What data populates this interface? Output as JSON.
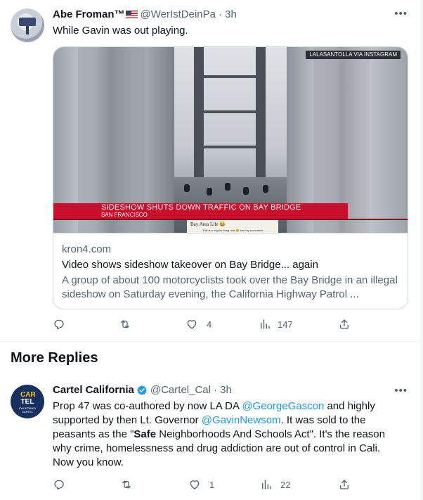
{
  "tweet1": {
    "name": "Abe Froman™",
    "handle": "@WerIstDeinPa",
    "time": "· 3h",
    "more_icon": "more-dots-icon",
    "text": "While Gavin was out playing.",
    "card": {
      "credit": "LALASANTOLLA VIA INSTAGRAM",
      "lower_third_title": "SIDESHOW SHUTS DOWN TRAFFIC ON BAY BRIDGE",
      "lower_third_location": "SAN FRANCISCO",
      "overlay_tag": "Bay Area Life 😂",
      "overlay_caption": "This is a regular thing now 😂 see my comments",
      "domain": "kron4.com",
      "title": "Video shows sideshow takeover on Bay Bridge... again",
      "description": "A group of about 100 motorcyclists took over the Bay Bridge in an illegal sideshow on Saturday evening, the California Highway Patrol ..."
    },
    "actions": {
      "reply_count": "",
      "retweet_count": "",
      "like_count": "4",
      "views_count": "147"
    }
  },
  "section_title": "More Replies",
  "tweet2": {
    "name": "Cartel California",
    "handle": "@Cartel_Cal",
    "time": "· 3h",
    "avatar_text": {
      "top": "CAR",
      "mid": "TEL",
      "bottom": "CALIFORNIA CARTEL"
    },
    "text_parts": {
      "p1": "Prop 47 was co-authored by now LA DA ",
      "mention1": "@GeorgeGascon",
      "p2": " and highly supported by then Lt. Governor ",
      "mention2": "@GavinNewsom",
      "p3": ". It was sold to the peasants as the \"",
      "bold": "Safe",
      "p4": " Neighborhoods And Schools Act\". It's the reason why crime, homelessness and drug addiction are out of control in Cali. Now you know."
    },
    "actions": {
      "reply_count": "",
      "retweet_count": "",
      "like_count": "1",
      "views_count": "22"
    }
  },
  "colors": {
    "link": "#1d9bf0",
    "secondary_text": "#536471",
    "verified": "#1d9bf0",
    "news_banner": "#c8102e"
  }
}
